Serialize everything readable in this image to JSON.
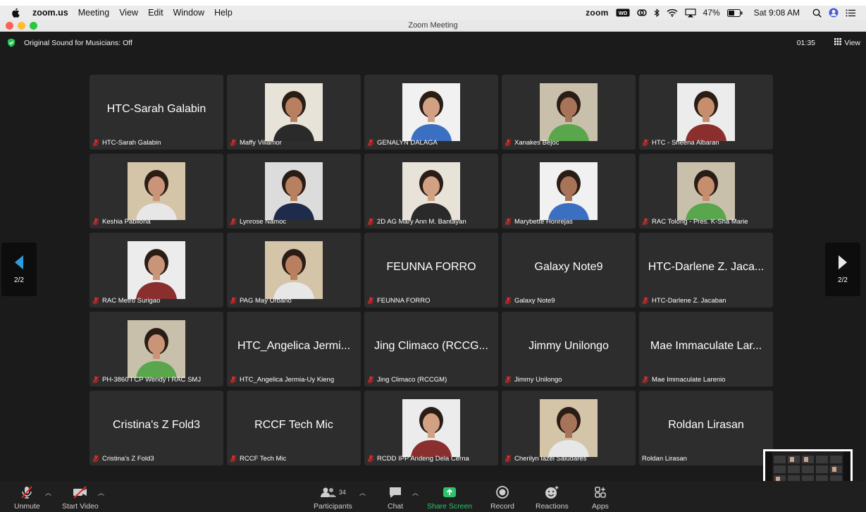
{
  "menubar": {
    "app_name": "zoom.us",
    "items": [
      "Meeting",
      "View",
      "Edit",
      "Window",
      "Help"
    ],
    "zoom_logo": "zoom",
    "battery": "47%",
    "clock": "Sat 9:08 AM"
  },
  "window": {
    "title": "Zoom Meeting",
    "original_sound": "Original Sound for Musicians: Off",
    "timer": "01:35",
    "view_label": "View"
  },
  "pager": {
    "left": "2/2",
    "right": "2/2"
  },
  "tiles": [
    {
      "label": "HTC-Sarah Galabin",
      "big": "HTC-Sarah Galabin",
      "photo": false
    },
    {
      "label": "Maffy Villamor",
      "big": "",
      "photo": true
    },
    {
      "label": "GENALYN DALAGA",
      "big": "",
      "photo": true
    },
    {
      "label": "Xanakes Bejoc",
      "big": "",
      "photo": true
    },
    {
      "label": "HTC - Sheena Albaran",
      "big": "",
      "photo": true
    },
    {
      "label": "Keshia Pabilona",
      "big": "",
      "photo": true
    },
    {
      "label": "Lynrose Namoc",
      "big": "",
      "photo": true
    },
    {
      "label": "2D AG Mary Ann M. Bantayan",
      "big": "",
      "photo": true
    },
    {
      "label": "Marybette Honrejas",
      "big": "",
      "photo": true
    },
    {
      "label": "RAC Tolong -  Pres. K-Sha Marie",
      "big": "",
      "photo": true
    },
    {
      "label": "RAC Metro Surigao",
      "big": "",
      "photo": true
    },
    {
      "label": "PAG May Urbano",
      "big": "",
      "photo": true
    },
    {
      "label": "FEUNNA FORRO",
      "big": "FEUNNA FORRO",
      "photo": false
    },
    {
      "label": "Galaxy Note9",
      "big": "Galaxy Note9",
      "photo": false
    },
    {
      "label": "HTC-Darlene Z. Jacaban",
      "big": "HTC-Darlene Z. Jaca...",
      "photo": false
    },
    {
      "label": "PH-3860 I CP Wendy I RAC SMJ",
      "big": "",
      "photo": true
    },
    {
      "label": "HTC_Angelica Jermia-Uy Kieng",
      "big": "HTC_Angelica Jermi...",
      "photo": false
    },
    {
      "label": "Jing Climaco (RCCGM)",
      "big": "Jing Climaco (RCCG...",
      "photo": false
    },
    {
      "label": "Jimmy Unilongo",
      "big": "Jimmy Unilongo",
      "photo": false
    },
    {
      "label": "Mae Immaculate Larenio",
      "big": "Mae Immaculate Lar...",
      "photo": false
    },
    {
      "label": "Cristina's Z Fold3",
      "big": "Cristina's Z Fold3",
      "photo": false
    },
    {
      "label": "RCCF Tech Mic",
      "big": "RCCF Tech Mic",
      "photo": false
    },
    {
      "label": "RCDD IPP Andeng Dela Cerna",
      "big": "",
      "photo": true
    },
    {
      "label": "Cherilyn lazel Saludares",
      "big": "",
      "photo": true
    },
    {
      "label": "Roldan Lirasan",
      "big": "Roldan Lirasan",
      "photo": false,
      "unmuted": true
    }
  ],
  "toolbar": {
    "unmute": "Unmute",
    "start_video": "Start Video",
    "participants": "Participants",
    "participants_count": "34",
    "chat": "Chat",
    "share_screen": "Share Screen",
    "record": "Record",
    "reactions": "Reactions",
    "apps": "Apps"
  },
  "colors": {
    "background": "#1b1b1b",
    "tile": "#2d2d2d",
    "share_green": "#2cc36b",
    "muted_red": "#e02b2b",
    "arrow_blue": "#2d9cdb"
  }
}
